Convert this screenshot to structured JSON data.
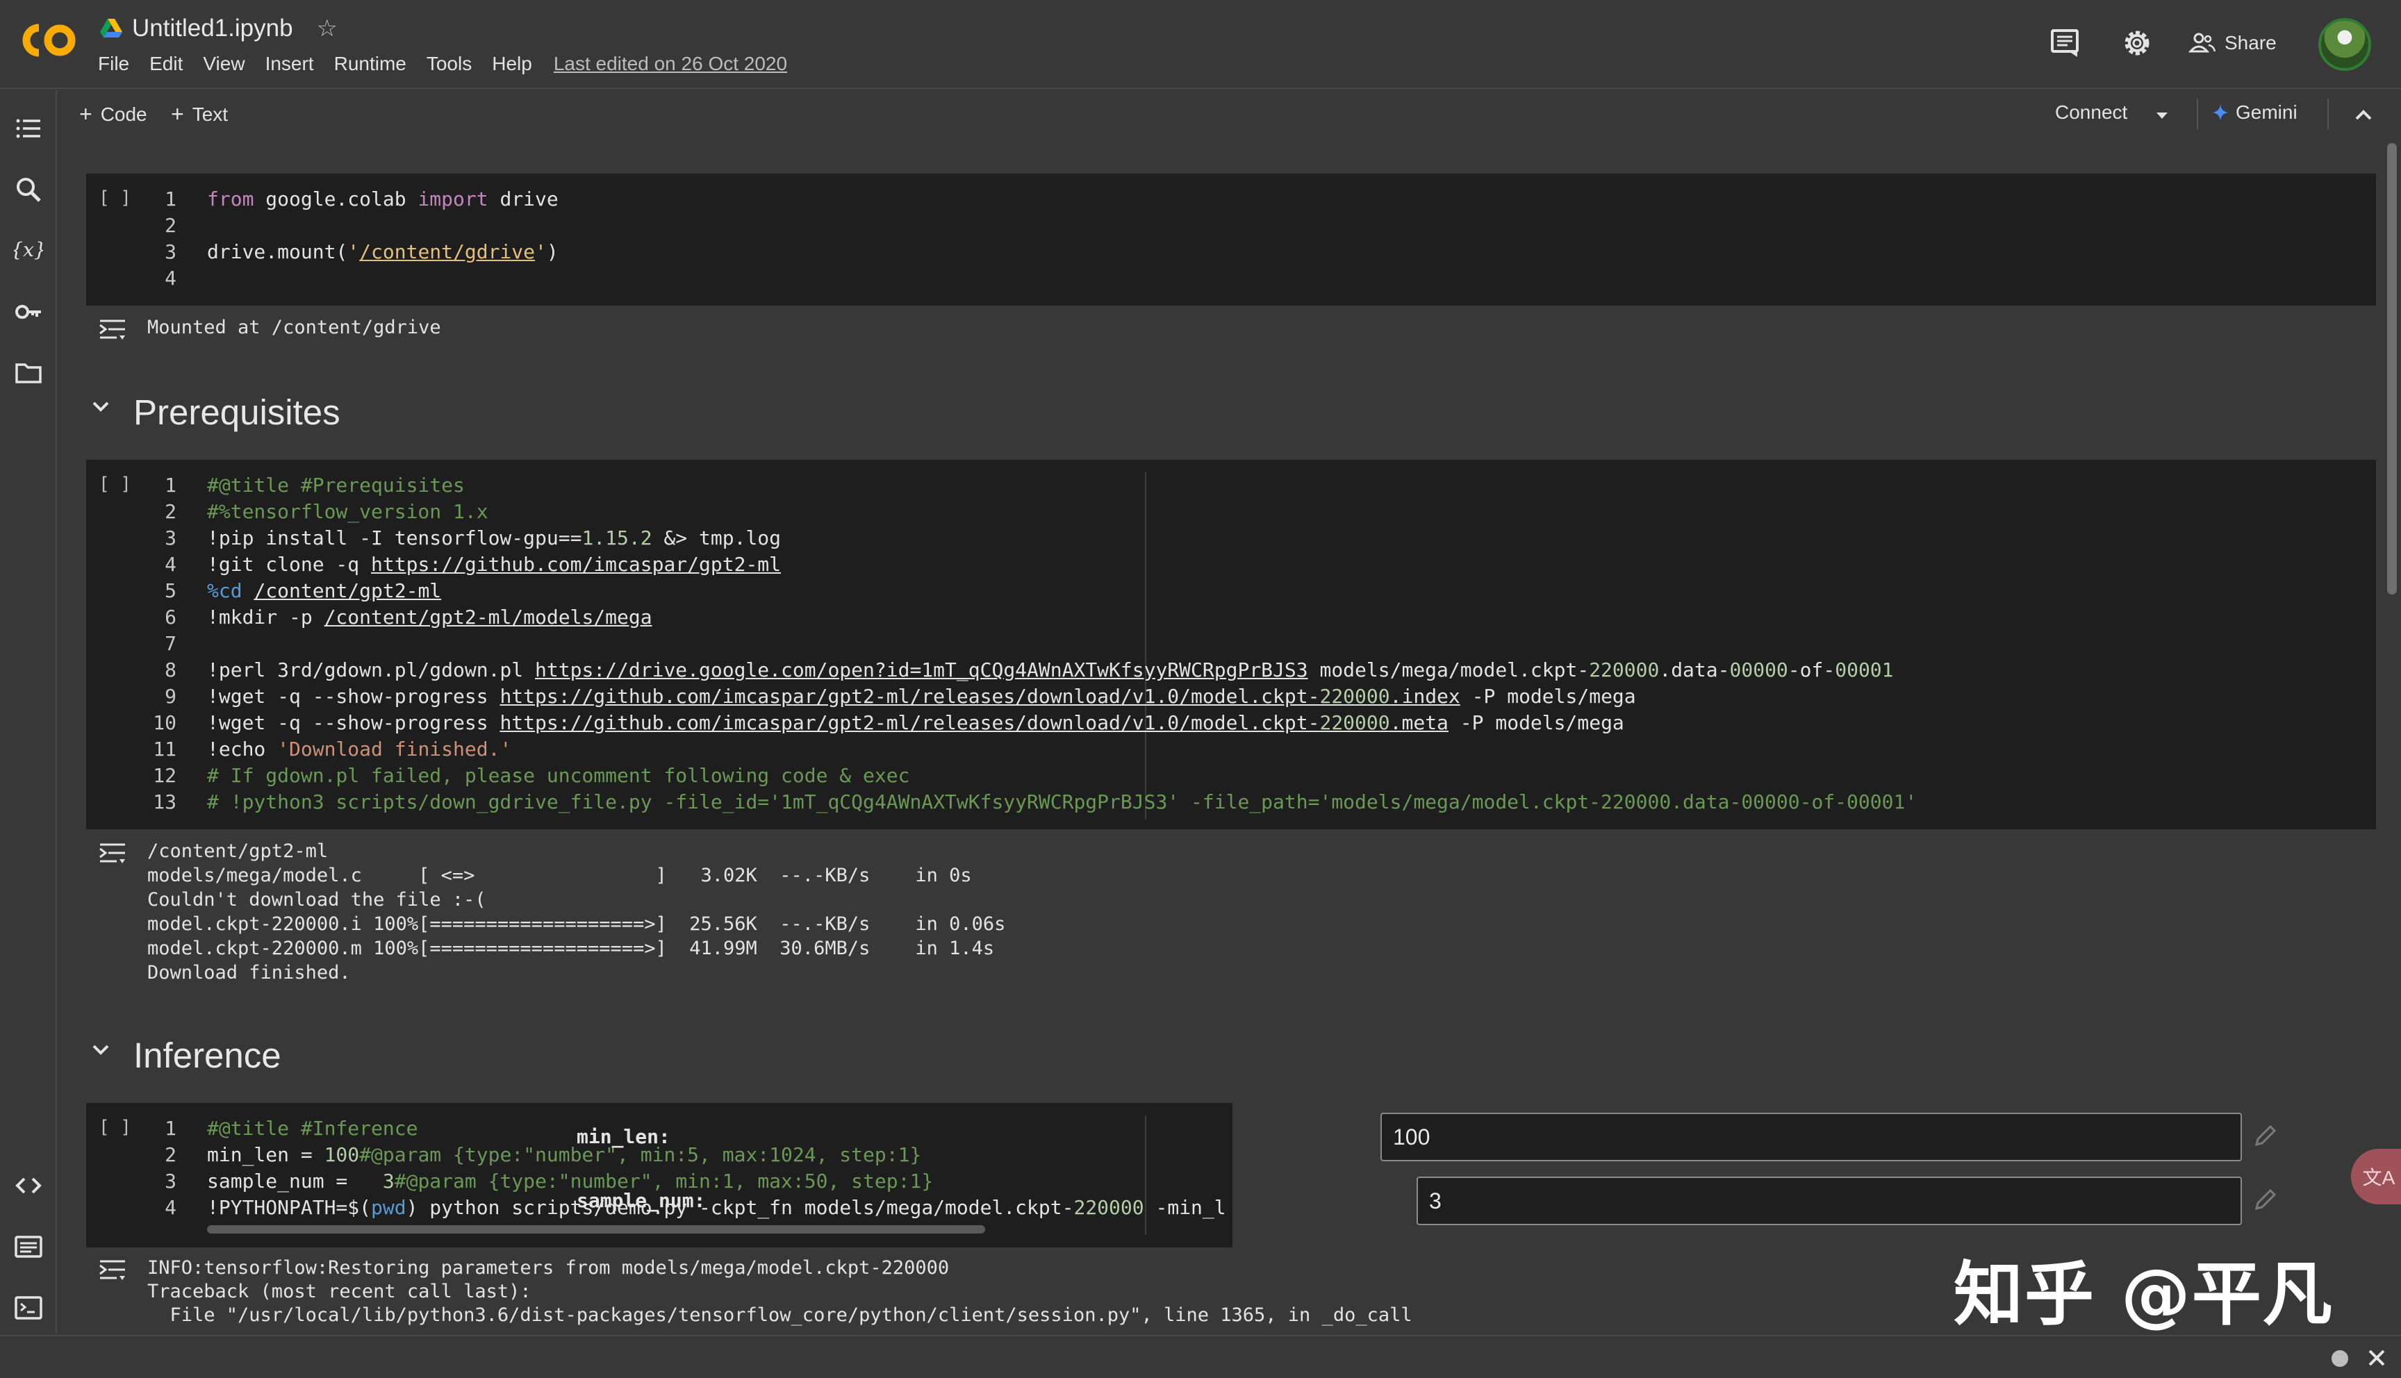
{
  "header": {
    "notebook_title": "Untitled1.ipynb",
    "menu": [
      "File",
      "Edit",
      "View",
      "Insert",
      "Runtime",
      "Tools",
      "Help"
    ],
    "last_edited": "Last edited on 26 Oct 2020",
    "share_label": "Share"
  },
  "toolbar": {
    "add_code": "Code",
    "add_text": "Text",
    "connect": "Connect",
    "gemini": "Gemini"
  },
  "cells": {
    "cell1": {
      "run_label": "[ ]",
      "line_numbers": [
        "1",
        "2",
        "3",
        "4"
      ],
      "line1": {
        "kw1": "from",
        "mod": " google.colab ",
        "kw2": "import",
        "rest": " drive"
      },
      "line3": {
        "pre": "drive.mount(",
        "q1": "'",
        "path": "/content/gdrive",
        "q2": "'",
        "post": ")"
      },
      "output": "Mounted at /content/gdrive"
    },
    "section1": {
      "title": "Prerequisites"
    },
    "cell2": {
      "run_label": "[ ]",
      "line_numbers": [
        "1",
        "2",
        "3",
        "4",
        "5",
        "6",
        "7",
        "8",
        "9",
        "10",
        "11",
        "12",
        "13"
      ],
      "l1": "#@title #Prerequisites",
      "l2": "#%tensorflow_version 1.x",
      "l3a": "!pip install -I tensorflow-gpu==",
      "l3b": "1.15.2",
      "l3c": " &> tmp.log",
      "l4a": "!git clone -q ",
      "l4b": "https://github.com/imcaspar/gpt2-ml",
      "l5a": "%cd",
      "l5b": " ",
      "l5c": "/content/gpt2-ml",
      "l6a": "!mkdir -p ",
      "l6b": "/content/gpt2-ml/models/mega",
      "l8a": "!perl 3rd/gdown.pl/gdown.pl ",
      "l8b": "https://drive.google.com/open?id=1mT_qCQg4AWnAXTwKfsyyRWCRpgPrBJS3",
      "l8c": " models/mega/model.ckpt-",
      "l8d": "220000",
      "l8e": ".data-",
      "l8f": "00000",
      "l8g": "-of-",
      "l8h": "00001",
      "l9a": "!wget -q --show-progress ",
      "l9b": "https://github.com/imcaspar/gpt2-ml/releases/download/v1.0/model.ckpt-",
      "l9c": "220000",
      "l9d": ".index",
      "l9e": " -P models/mega",
      "l10a": "!wget -q --show-progress ",
      "l10b": "https://github.com/imcaspar/gpt2-ml/releases/download/v1.0/model.ckpt-",
      "l10c": "220000",
      "l10d": ".meta",
      "l10e": " -P models/mega",
      "l11a": "!echo ",
      "l11b": "'Download finished.'",
      "l12": "# If gdown.pl failed, please uncomment following code & exec",
      "l13": "# !python3 scripts/down_gdrive_file.py -file_id='1mT_qCQg4AWnAXTwKfsyyRWCRpgPrBJS3' -file_path='models/mega/model.ckpt-220000.data-00000-of-00001'",
      "output": [
        "/content/gpt2-ml",
        "models/mega/model.c     [ <=>                ]   3.02K  --.-KB/s    in 0s",
        "Couldn't download the file :-(",
        "model.ckpt-220000.i 100%[===================>]  25.56K  --.-KB/s    in 0.06s",
        "model.ckpt-220000.m 100%[===================>]  41.99M  30.6MB/s    in 1.4s",
        "Download finished."
      ]
    },
    "section2": {
      "title": "Inference"
    },
    "cell3": {
      "run_label": "[ ]",
      "line_numbers": [
        "1",
        "2",
        "3",
        "4"
      ],
      "l1": "#@title #Inference",
      "l2a": "min_len = ",
      "l2b": "100",
      "l2c": "#@param {type:\"number\", min:5, max:1024, step:1}",
      "l3a": "sample_num =   ",
      "l3b": "3",
      "l3c": "#@param {type:\"number\", min:1, max:50, step:1}",
      "l4a": "!PYTHONPATH=$(",
      "l4b": "pwd",
      "l4c": ") python scripts/demo.py -ckpt_fn models/mega/model.ckpt-",
      "l4d": "220000",
      "l4e": " -min_l",
      "form": {
        "min_len_label": "min_len:",
        "min_len_value": "100",
        "sample_num_label": "sample_num:",
        "sample_num_value": "3"
      },
      "output": [
        "INFO:tensorflow:Restoring parameters from models/mega/model.ckpt-220000",
        "Traceback (most recent call last):",
        "  File \"/usr/local/lib/python3.6/dist-packages/tensorflow_core/python/client/session.py\", line 1365, in _do_call"
      ]
    }
  },
  "watermark": "知乎 @平凡",
  "translate_glyph": "文A",
  "icons": {
    "rail": [
      "toc-icon",
      "search-icon",
      "variables-icon",
      "secrets-key-icon",
      "files-folder-icon",
      "code-snippets-icon",
      "command-palette-icon",
      "terminal-icon"
    ],
    "header": [
      "comments-icon",
      "settings-gear-icon",
      "share-people-icon"
    ]
  }
}
